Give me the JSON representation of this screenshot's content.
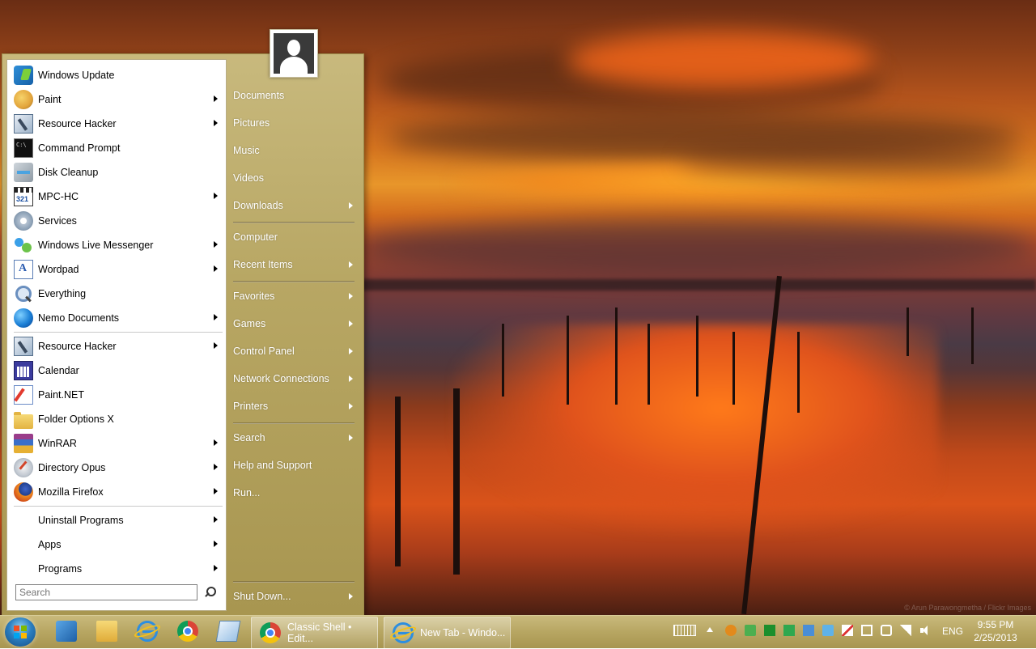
{
  "start_menu": {
    "left_items": [
      {
        "label": "Windows Update",
        "icon": "windows-update-icon",
        "submenu": false
      },
      {
        "label": "Paint",
        "icon": "paint-icon",
        "submenu": true
      },
      {
        "label": "Resource Hacker",
        "icon": "resource-hacker-icon",
        "submenu": true
      },
      {
        "label": "Command Prompt",
        "icon": "command-prompt-icon",
        "submenu": false
      },
      {
        "label": "Disk Cleanup",
        "icon": "disk-cleanup-icon",
        "submenu": false
      },
      {
        "label": "MPC-HC",
        "icon": "mpc-hc-icon",
        "submenu": true
      },
      {
        "label": "Services",
        "icon": "services-icon",
        "submenu": false
      },
      {
        "label": "Windows Live Messenger",
        "icon": "messenger-icon",
        "submenu": true
      },
      {
        "label": "Wordpad",
        "icon": "wordpad-icon",
        "submenu": true
      },
      {
        "label": "Everything",
        "icon": "everything-icon",
        "submenu": false
      },
      {
        "label": "Nemo Documents",
        "icon": "nemo-documents-icon",
        "submenu": true
      },
      {
        "label": "Resource Hacker",
        "icon": "resource-hacker-icon",
        "submenu": true
      },
      {
        "label": "Calendar",
        "icon": "calendar-icon",
        "submenu": false
      },
      {
        "label": "Paint.NET",
        "icon": "paintnet-icon",
        "submenu": false
      },
      {
        "label": "Folder Options X",
        "icon": "folder-icon",
        "submenu": false
      },
      {
        "label": "WinRAR",
        "icon": "winrar-icon",
        "submenu": true
      },
      {
        "label": "Directory Opus",
        "icon": "directory-opus-icon",
        "submenu": true
      },
      {
        "label": "Mozilla Firefox",
        "icon": "firefox-icon",
        "submenu": true
      },
      {
        "label": "Uninstall Programs",
        "icon": "",
        "submenu": true
      },
      {
        "label": "Apps",
        "icon": "",
        "submenu": true
      },
      {
        "label": "Programs",
        "icon": "",
        "submenu": true
      }
    ],
    "search": {
      "placeholder": "Search",
      "value": ""
    },
    "right_items": [
      {
        "label": "Documents",
        "submenu": false
      },
      {
        "label": "Pictures",
        "submenu": false
      },
      {
        "label": "Music",
        "submenu": false
      },
      {
        "label": "Videos",
        "submenu": false
      },
      {
        "label": "Downloads",
        "submenu": true
      },
      {
        "label": "Computer",
        "submenu": false
      },
      {
        "label": "Recent Items",
        "submenu": true
      },
      {
        "label": "Favorites",
        "submenu": true
      },
      {
        "label": "Games",
        "submenu": true
      },
      {
        "label": "Control Panel",
        "submenu": true
      },
      {
        "label": "Network Connections",
        "submenu": true
      },
      {
        "label": "Printers",
        "submenu": true
      },
      {
        "label": "Search",
        "submenu": true
      },
      {
        "label": "Help and Support",
        "submenu": false
      },
      {
        "label": "Run...",
        "submenu": false
      }
    ],
    "shutdown": {
      "label": "Shut Down...",
      "submenu": true
    }
  },
  "taskbar": {
    "pinned": [
      "explorer-tool-icon",
      "file-explorer-icon",
      "internet-explorer-icon",
      "chrome-icon",
      "notepad-icon"
    ],
    "running": [
      {
        "label": "Classic Shell • Edit...",
        "icon": "chrome-icon"
      },
      {
        "label": "New Tab - Windo...",
        "icon": "internet-explorer-icon"
      }
    ],
    "language": "ENG",
    "time": "9:55 PM",
    "date": "2/25/2013"
  },
  "wallpaper": {
    "credit": "© Arun Parawongmetha / Flickr Images"
  },
  "colors": {
    "menu_gold": "#b8a764",
    "taskbar_gold": "#b7a662"
  }
}
